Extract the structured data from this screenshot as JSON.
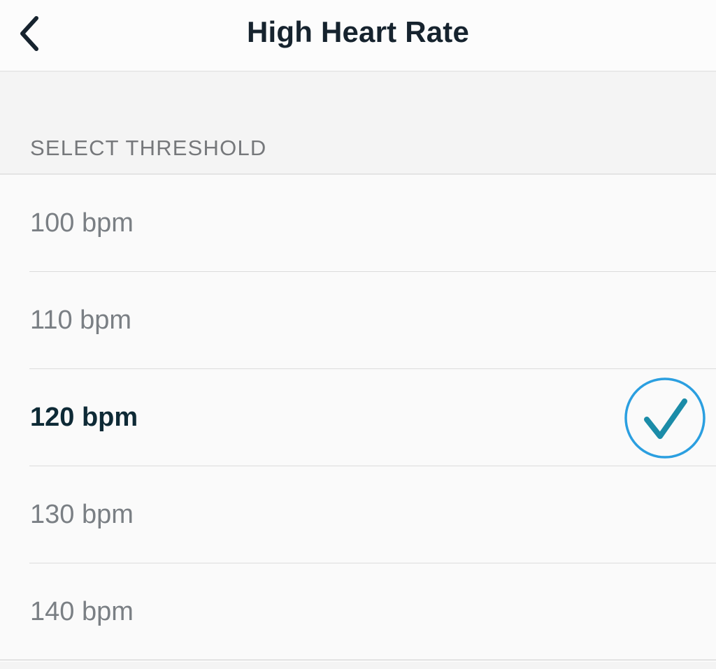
{
  "nav": {
    "title": "High Heart Rate",
    "back_icon": "chevron-left-icon"
  },
  "section": {
    "header": "SELECT THRESHOLD"
  },
  "options": [
    {
      "label": "100 bpm",
      "selected": false
    },
    {
      "label": "110 bpm",
      "selected": false
    },
    {
      "label": "120 bpm",
      "selected": true
    },
    {
      "label": "130 bpm",
      "selected": false
    },
    {
      "label": "140 bpm",
      "selected": false
    }
  ],
  "colors": {
    "title": "#16232e",
    "selected_text": "#0e2a36",
    "unselected_text": "#7a7f84",
    "check_circle": "#2b9fe0",
    "check_mark": "#1b8ca8"
  }
}
